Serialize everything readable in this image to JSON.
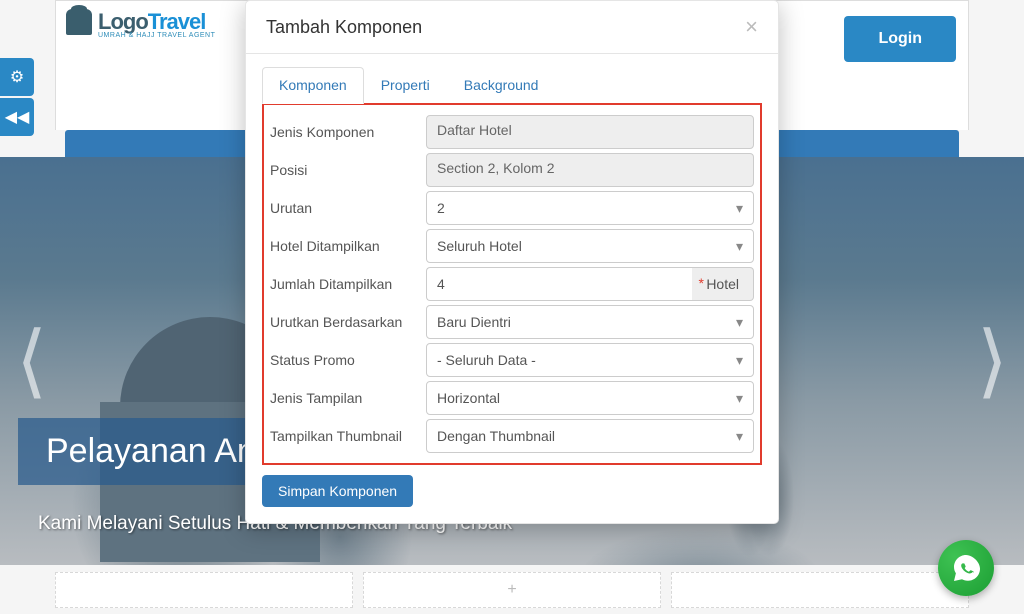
{
  "brand": {
    "part1": "Logo",
    "part2": "Travel",
    "tag": "UMRAH & HAJJ TRAVEL AGENT"
  },
  "plus": "+",
  "login": "Login",
  "hero": {
    "title": "Pelayanan Amanah",
    "subtitle": "Kami Melayani Setulus Hati & Memberikan Yang Terbaik"
  },
  "modal": {
    "title": "Tambah Komponen",
    "tabs": {
      "komponen": "Komponen",
      "properti": "Properti",
      "background": "Background"
    },
    "fields": {
      "jenis_label": "Jenis Komponen",
      "jenis_value": "Daftar Hotel",
      "posisi_label": "Posisi",
      "posisi_value": "Section 2, Kolom 2",
      "urutan_label": "Urutan",
      "urutan_value": "2",
      "hotel_label": "Hotel Ditampilkan",
      "hotel_value": "Seluruh Hotel",
      "jumlah_label": "Jumlah Ditampilkan",
      "jumlah_value": "4",
      "jumlah_unit": "Hotel",
      "urutkan_label": "Urutkan Berdasarkan",
      "urutkan_value": "Baru Dientri",
      "promo_label": "Status Promo",
      "promo_value": "- Seluruh Data -",
      "tampilan_label": "Jenis Tampilan",
      "tampilan_value": "Horizontal",
      "thumb_label": "Tampilkan Thumbnail",
      "thumb_value": "Dengan Thumbnail"
    },
    "save": "Simpan Komponen"
  }
}
